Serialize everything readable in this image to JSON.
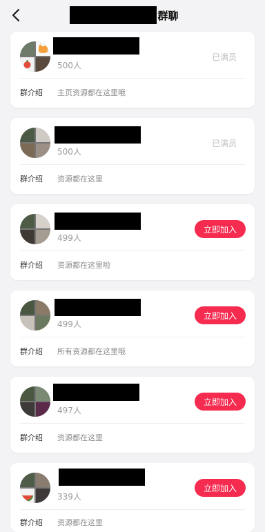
{
  "header": {
    "title_suffix": "群聊"
  },
  "groups": [
    {
      "members": "500人",
      "status": "已满员",
      "intro_label": "群介绍",
      "intro": "主页资源都在这里哦"
    },
    {
      "members": "500人",
      "status": "已满员",
      "intro_label": "群介绍",
      "intro": "资源都在这里"
    },
    {
      "members": "499人",
      "status": "立即加入",
      "intro_label": "群介绍",
      "intro": "资源都在这里啦"
    },
    {
      "members": "499人",
      "status": "立即加入",
      "intro_label": "群介绍",
      "intro": "所有资源都在这里哦"
    },
    {
      "members": "497人",
      "status": "立即加入",
      "intro_label": "群介绍",
      "intro": "资源都在这里"
    },
    {
      "members": "339人",
      "status": "立即加入",
      "intro_label": "群介绍",
      "intro": "资源都在这里"
    }
  ],
  "colors": {
    "accent": "#f52b4f",
    "background": "#f3f3f5"
  }
}
